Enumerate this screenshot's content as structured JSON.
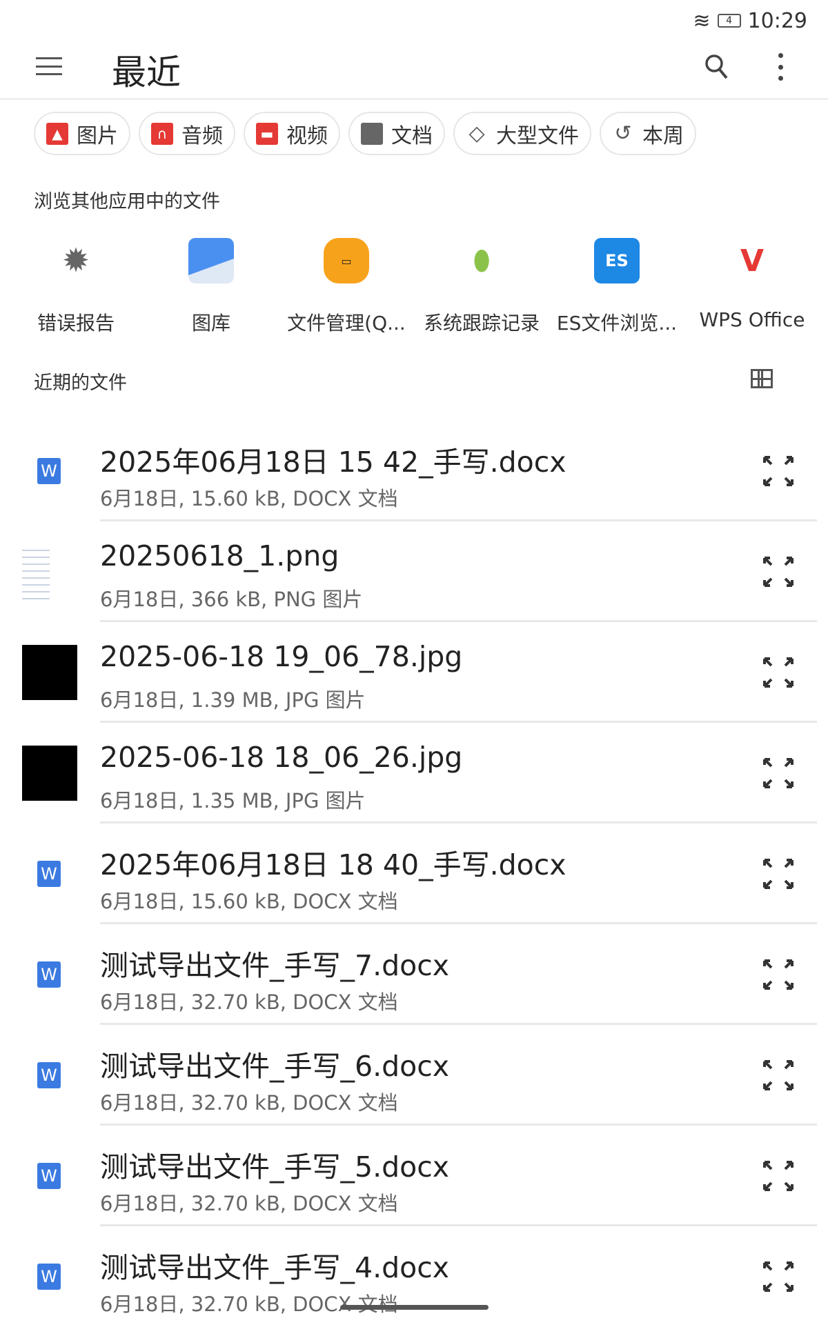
{
  "status": {
    "time": "10:29",
    "battery": "4"
  },
  "header": {
    "title": "最近"
  },
  "chips": [
    {
      "label": "图片",
      "icon": "image-icon",
      "color": "#e53935"
    },
    {
      "label": "音频",
      "icon": "headphones-icon",
      "color": "#e53935"
    },
    {
      "label": "视频",
      "icon": "clapperboard-icon",
      "color": "#e53935"
    },
    {
      "label": "文档",
      "icon": "document-icon",
      "color": "#666666"
    },
    {
      "label": "大型文件",
      "icon": "tag-icon",
      "color": "#555555"
    },
    {
      "label": "本周",
      "icon": "history-icon",
      "color": "#555555"
    }
  ],
  "browse_section": "浏览其他应用中的文件",
  "apps": [
    {
      "label": "错误报告",
      "icon": "bug-icon"
    },
    {
      "label": "图库",
      "icon": "gallery-icon"
    },
    {
      "label": "文件管理(Q...",
      "icon": "file-manager-icon"
    },
    {
      "label": "系统跟踪记录",
      "icon": "android-icon"
    },
    {
      "label": "ES文件浏览...",
      "icon": "es-file-explorer-icon"
    },
    {
      "label": "WPS Office",
      "icon": "wps-icon"
    }
  ],
  "recent_section": "近期的文件",
  "files": [
    {
      "name": "2025年06月18日 15 42_手写.docx",
      "meta": "6月18日, 15.60 kB, DOCX 文档",
      "type": "docx"
    },
    {
      "name": "20250618_1.png",
      "meta": "6月18日, 366 kB, PNG 图片",
      "type": "png"
    },
    {
      "name": "2025-06-18 19_06_78.jpg",
      "meta": "6月18日, 1.39 MB, JPG 图片",
      "type": "jpg"
    },
    {
      "name": "2025-06-18 18_06_26.jpg",
      "meta": "6月18日, 1.35 MB, JPG 图片",
      "type": "jpg"
    },
    {
      "name": "2025年06月18日 18 40_手写.docx",
      "meta": "6月18日, 15.60 kB, DOCX 文档",
      "type": "docx"
    },
    {
      "name": "测试导出文件_手写_7.docx",
      "meta": "6月18日, 32.70 kB, DOCX 文档",
      "type": "docx"
    },
    {
      "name": "测试导出文件_手写_6.docx",
      "meta": "6月18日, 32.70 kB, DOCX 文档",
      "type": "docx"
    },
    {
      "name": "测试导出文件_手写_5.docx",
      "meta": "6月18日, 32.70 kB, DOCX 文档",
      "type": "docx"
    },
    {
      "name": "测试导出文件_手写_4.docx",
      "meta": "6月18日, 32.70 kB, DOCX 文档",
      "type": "docx"
    }
  ]
}
